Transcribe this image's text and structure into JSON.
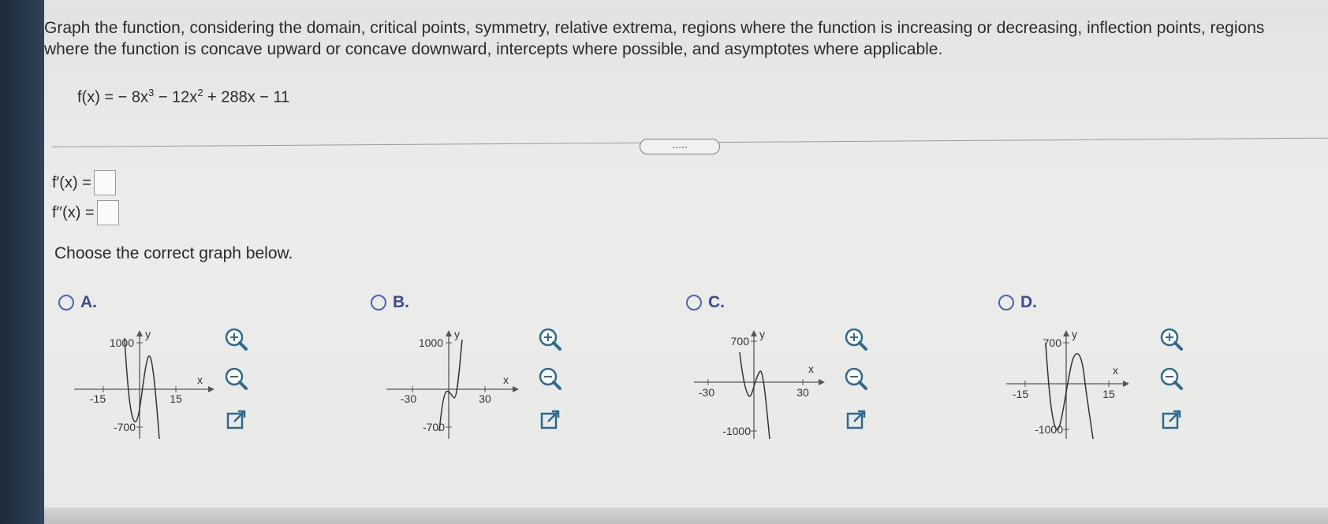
{
  "question": {
    "text": "Graph the function, considering the domain, critical points, symmetry, relative extrema, regions where the function is increasing or decreasing, inflection points, regions where the function is concave upward or concave downward, intercepts where possible, and asymptotes where applicable.",
    "function_lhs": "f(x) = − 8x",
    "exp3": "3",
    "term2": " − 12x",
    "exp2": "2",
    "tail": " + 288x − 11"
  },
  "expander_label": ".....",
  "derivatives": {
    "first_label": "f′(x) =",
    "second_label": "f′′(x) ="
  },
  "prompt": "Choose the correct graph below.",
  "options": [
    {
      "letter": "A.",
      "y_top": "1000",
      "y_bottom": "-700",
      "x_left": "-15",
      "x_right": "15",
      "x_axis": "x",
      "y_axis": "y"
    },
    {
      "letter": "B.",
      "y_top": "1000",
      "y_bottom": "-700",
      "x_left": "-30",
      "x_right": "30",
      "x_axis": "x",
      "y_axis": "y"
    },
    {
      "letter": "C.",
      "y_top": "700",
      "y_bottom": "-1000",
      "x_left": "-30",
      "x_right": "30",
      "x_axis": "x",
      "y_axis": "y"
    },
    {
      "letter": "D.",
      "y_top": "700",
      "y_bottom": "-1000",
      "x_left": "-15",
      "x_right": "15",
      "x_axis": "x",
      "y_axis": "y"
    }
  ],
  "tools": {
    "zoom_in": "zoom-in-icon",
    "zoom_out": "zoom-out-icon",
    "open": "open-external-icon"
  },
  "colors": {
    "accent": "#4b63b5",
    "text": "#2b2b2b"
  }
}
